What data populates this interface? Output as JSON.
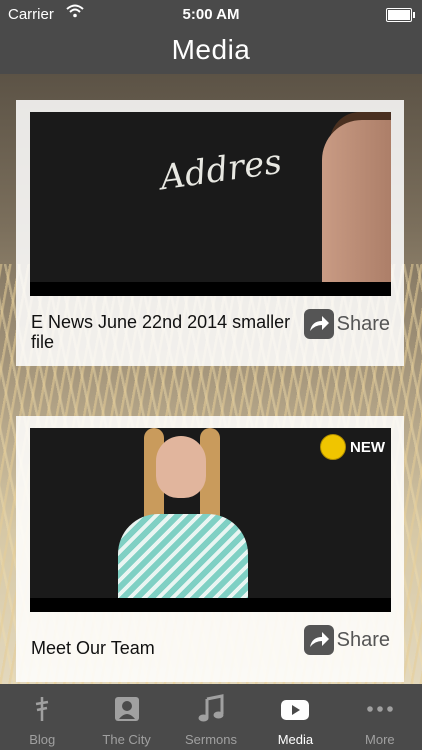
{
  "status": {
    "carrier": "Carrier",
    "time": "5:00 AM"
  },
  "header": {
    "title": "Media"
  },
  "cards": [
    {
      "title": "E News June 22nd 2014 smaller file",
      "share_label": "Share",
      "chalk_text": "Addres"
    },
    {
      "title": "Meet Our Team",
      "share_label": "Share",
      "badge": "NEW"
    }
  ],
  "tabs": [
    {
      "label": "Blog",
      "icon": "blog-icon"
    },
    {
      "label": "The City",
      "icon": "city-icon"
    },
    {
      "label": "Sermons",
      "icon": "music-note-icon"
    },
    {
      "label": "Media",
      "icon": "play-video-icon"
    },
    {
      "label": "More",
      "icon": "more-dots-icon"
    }
  ],
  "colors": {
    "bar_bg": "#4a4a4a",
    "tab_active": "#ffffff",
    "tab_inactive": "#a0a0a0",
    "badge": "#f0c500"
  },
  "active_tab": "Media"
}
